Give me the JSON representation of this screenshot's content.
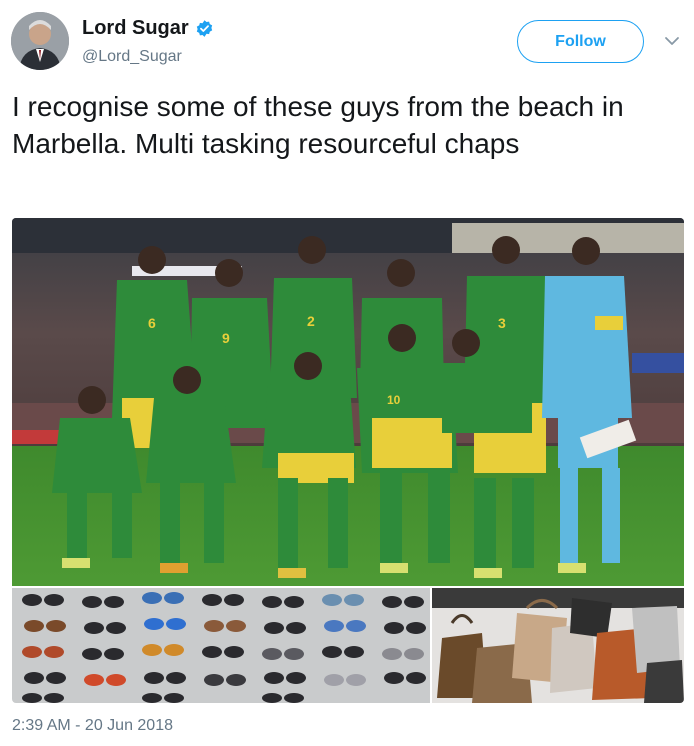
{
  "author": {
    "name": "Lord Sugar",
    "handle": "@Lord_Sugar",
    "verified_icon": "verified-badge-icon",
    "avatar_icon": "profile-avatar"
  },
  "follow_button": {
    "label": "Follow"
  },
  "menu": {
    "icon": "chevron-down-icon"
  },
  "tweet": {
    "text": "I recognise some of these guys from the beach in Marbella. Multi tasking resourceful chaps",
    "timestamp": "2:39 AM - 20 Jun 2018"
  },
  "media": {
    "main_photo": {
      "subject": "football team photo",
      "jersey_numbers": [
        "6",
        "9",
        "2",
        "3",
        "10"
      ]
    },
    "sunglasses_photo": {
      "subject": "sunglasses display"
    },
    "bags_photo": {
      "subject": "handbags display"
    }
  },
  "colors": {
    "brand_blue": "#1da1f2",
    "text_primary": "#14171a",
    "text_secondary": "#657786",
    "jersey_green": "#2e8b3a",
    "shorts_yellow": "#e8cf3a",
    "keeper_blue": "#5fb8e0"
  }
}
